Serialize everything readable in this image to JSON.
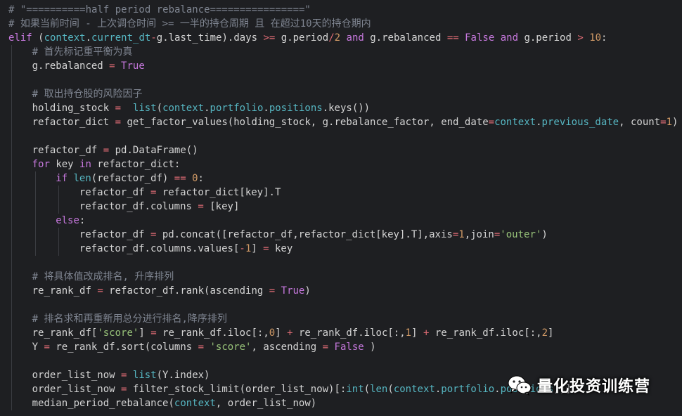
{
  "theme": {
    "background": "#1e1f22",
    "comment": "#7f8591",
    "keyword": "#c678dd",
    "attribute": "#56b6c2",
    "number": "#d19a66",
    "string": "#98c379",
    "operator": "#e06c75",
    "text": "#d4d4d4"
  },
  "editor": {
    "lines": [
      {
        "indent": 0,
        "tokens": [
          [
            "comment",
            "# \"==========half period rebalance================\""
          ]
        ]
      },
      {
        "indent": 0,
        "tokens": [
          [
            "comment",
            "# 如果当前时间 - 上次调仓时间 >= 一半的持仓周期 且 在超过10天的持仓期内"
          ]
        ]
      },
      {
        "indent": 0,
        "tokens": [
          [
            "kw",
            "elif"
          ],
          [
            "plain",
            " ("
          ],
          [
            "attr",
            "context"
          ],
          [
            "plain",
            "."
          ],
          [
            "attr",
            "current_dt"
          ],
          [
            "op",
            "-"
          ],
          [
            "plain",
            "g.last_time).days "
          ],
          [
            "op",
            ">="
          ],
          [
            "plain",
            " g.period"
          ],
          [
            "op",
            "/"
          ],
          [
            "num",
            "2"
          ],
          [
            "plain",
            " "
          ],
          [
            "kw",
            "and"
          ],
          [
            "plain",
            " g.rebalanced "
          ],
          [
            "op",
            "=="
          ],
          [
            "plain",
            " "
          ],
          [
            "const",
            "False"
          ],
          [
            "plain",
            " "
          ],
          [
            "kw",
            "and"
          ],
          [
            "plain",
            " g.period "
          ],
          [
            "op",
            ">"
          ],
          [
            "plain",
            " "
          ],
          [
            "num",
            "10"
          ],
          [
            "plain",
            ":"
          ]
        ]
      },
      {
        "indent": 1,
        "tokens": [
          [
            "comment",
            "# 首先标记重平衡为真"
          ]
        ]
      },
      {
        "indent": 1,
        "tokens": [
          [
            "plain",
            "g.rebalanced "
          ],
          [
            "op",
            "="
          ],
          [
            "plain",
            " "
          ],
          [
            "const",
            "True"
          ]
        ]
      },
      {
        "indent": 1,
        "tokens": []
      },
      {
        "indent": 1,
        "tokens": [
          [
            "comment",
            "# 取出持仓股的风险因子"
          ]
        ]
      },
      {
        "indent": 1,
        "tokens": [
          [
            "plain",
            "holding_stock "
          ],
          [
            "op",
            "="
          ],
          [
            "plain",
            "  "
          ],
          [
            "builtin",
            "list"
          ],
          [
            "plain",
            "("
          ],
          [
            "attr",
            "context"
          ],
          [
            "plain",
            "."
          ],
          [
            "attr",
            "portfolio"
          ],
          [
            "plain",
            "."
          ],
          [
            "attr",
            "positions"
          ],
          [
            "plain",
            ".keys())"
          ]
        ]
      },
      {
        "indent": 1,
        "tokens": [
          [
            "plain",
            "refactor_dict "
          ],
          [
            "op",
            "="
          ],
          [
            "plain",
            " get_factor_values(holding_stock, g.rebalance_factor, end_date"
          ],
          [
            "op",
            "="
          ],
          [
            "attr",
            "context"
          ],
          [
            "plain",
            "."
          ],
          [
            "attr",
            "previous_date"
          ],
          [
            "plain",
            ", count"
          ],
          [
            "op",
            "="
          ],
          [
            "num",
            "1"
          ],
          [
            "plain",
            ")"
          ]
        ]
      },
      {
        "indent": 1,
        "tokens": []
      },
      {
        "indent": 1,
        "tokens": [
          [
            "plain",
            "refactor_df "
          ],
          [
            "op",
            "="
          ],
          [
            "plain",
            " pd.DataFrame()"
          ]
        ]
      },
      {
        "indent": 1,
        "tokens": [
          [
            "kw",
            "for"
          ],
          [
            "plain",
            " key "
          ],
          [
            "kw",
            "in"
          ],
          [
            "plain",
            " refactor_dict:"
          ]
        ]
      },
      {
        "indent": 2,
        "tokens": [
          [
            "kw",
            "if"
          ],
          [
            "plain",
            " "
          ],
          [
            "builtin",
            "len"
          ],
          [
            "plain",
            "(refactor_df) "
          ],
          [
            "op",
            "=="
          ],
          [
            "plain",
            " "
          ],
          [
            "num",
            "0"
          ],
          [
            "plain",
            ":"
          ]
        ]
      },
      {
        "indent": 3,
        "tokens": [
          [
            "plain",
            "refactor_df "
          ],
          [
            "op",
            "="
          ],
          [
            "plain",
            " refactor_dict[key].T"
          ]
        ]
      },
      {
        "indent": 3,
        "tokens": [
          [
            "plain",
            "refactor_df.columns "
          ],
          [
            "op",
            "="
          ],
          [
            "plain",
            " [key]"
          ]
        ]
      },
      {
        "indent": 2,
        "tokens": [
          [
            "kw",
            "else"
          ],
          [
            "plain",
            ":"
          ]
        ]
      },
      {
        "indent": 3,
        "tokens": [
          [
            "plain",
            "refactor_df "
          ],
          [
            "op",
            "="
          ],
          [
            "plain",
            " pd.concat([refactor_df,refactor_dict[key].T],axis"
          ],
          [
            "op",
            "="
          ],
          [
            "num",
            "1"
          ],
          [
            "plain",
            ",join"
          ],
          [
            "op",
            "="
          ],
          [
            "str",
            "'outer'"
          ],
          [
            "plain",
            ")"
          ]
        ]
      },
      {
        "indent": 3,
        "tokens": [
          [
            "plain",
            "refactor_df.columns.values["
          ],
          [
            "op",
            "-"
          ],
          [
            "num",
            "1"
          ],
          [
            "plain",
            "] "
          ],
          [
            "op",
            "="
          ],
          [
            "plain",
            " key"
          ]
        ]
      },
      {
        "indent": 1,
        "tokens": []
      },
      {
        "indent": 1,
        "tokens": [
          [
            "comment",
            "# 将具体值改成排名, 升序排列"
          ]
        ]
      },
      {
        "indent": 1,
        "tokens": [
          [
            "plain",
            "re_rank_df "
          ],
          [
            "op",
            "="
          ],
          [
            "plain",
            " refactor_df.rank(ascending "
          ],
          [
            "op",
            "="
          ],
          [
            "plain",
            " "
          ],
          [
            "const",
            "True"
          ],
          [
            "plain",
            ")"
          ]
        ]
      },
      {
        "indent": 1,
        "tokens": []
      },
      {
        "indent": 1,
        "tokens": [
          [
            "comment",
            "# 排名求和再重新用总分进行排名,降序排列"
          ]
        ]
      },
      {
        "indent": 1,
        "tokens": [
          [
            "plain",
            "re_rank_df["
          ],
          [
            "str",
            "'score'"
          ],
          [
            "plain",
            "] "
          ],
          [
            "op",
            "="
          ],
          [
            "plain",
            " re_rank_df.iloc[:,"
          ],
          [
            "num",
            "0"
          ],
          [
            "plain",
            "] "
          ],
          [
            "op",
            "+"
          ],
          [
            "plain",
            " re_rank_df.iloc[:,"
          ],
          [
            "num",
            "1"
          ],
          [
            "plain",
            "] "
          ],
          [
            "op",
            "+"
          ],
          [
            "plain",
            " re_rank_df.iloc[:,"
          ],
          [
            "num",
            "2"
          ],
          [
            "plain",
            "]"
          ]
        ]
      },
      {
        "indent": 1,
        "tokens": [
          [
            "plain",
            "Y "
          ],
          [
            "op",
            "="
          ],
          [
            "plain",
            " re_rank_df.sort(columns "
          ],
          [
            "op",
            "="
          ],
          [
            "plain",
            " "
          ],
          [
            "str",
            "'score'"
          ],
          [
            "plain",
            ", ascending "
          ],
          [
            "op",
            "="
          ],
          [
            "plain",
            " "
          ],
          [
            "const",
            "False"
          ],
          [
            "plain",
            " )"
          ]
        ]
      },
      {
        "indent": 1,
        "tokens": []
      },
      {
        "indent": 1,
        "tokens": [
          [
            "plain",
            "order_list_now "
          ],
          [
            "op",
            "="
          ],
          [
            "plain",
            " "
          ],
          [
            "builtin",
            "list"
          ],
          [
            "plain",
            "(Y.index)"
          ]
        ]
      },
      {
        "indent": 1,
        "tokens": [
          [
            "plain",
            "order_list_now "
          ],
          [
            "op",
            "="
          ],
          [
            "plain",
            " filter_stock_limit(order_list_now)[:"
          ],
          [
            "builtin",
            "int"
          ],
          [
            "plain",
            "("
          ],
          [
            "builtin",
            "len"
          ],
          [
            "plain",
            "("
          ],
          [
            "attr",
            "context"
          ],
          [
            "plain",
            "."
          ],
          [
            "attr",
            "portfolio"
          ],
          [
            "plain",
            "."
          ],
          [
            "attr",
            "positions"
          ],
          [
            "plain",
            "))]"
          ]
        ]
      },
      {
        "indent": 1,
        "tokens": [
          [
            "plain",
            "median_period_rebalance("
          ],
          [
            "attr",
            "context"
          ],
          [
            "plain",
            ", order_list_now)"
          ]
        ]
      }
    ]
  },
  "watermark": {
    "icon": "wechat-icon",
    "text": "量化投资训练营"
  }
}
